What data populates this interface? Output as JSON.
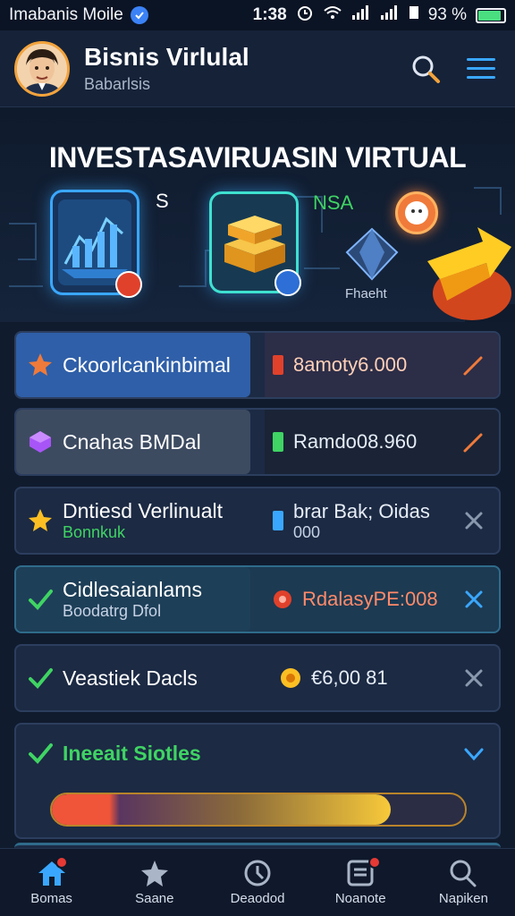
{
  "status_bar": {
    "carrier": "Imabanis Moile",
    "time": "1:38",
    "battery": "93 %"
  },
  "header": {
    "title": "Bisnis Virlulal",
    "subtitle": "Babarlsis"
  },
  "hero": {
    "headline": "INVESTASAVIRUASIN VIRTUAL",
    "label_s": "S",
    "label_nsa": "NSA",
    "label_fracht": "Fhaeht"
  },
  "cards": [
    {
      "title": "Ckoorlcankinbimal",
      "subtitle": "",
      "value": "8amoty6.000",
      "value2": ""
    },
    {
      "title": "Cnahas BMDal",
      "subtitle": "",
      "value": "Ramdo08.960",
      "value2": ""
    },
    {
      "title": "Dntiesd Verlinualt",
      "subtitle": "Bonnkuk",
      "value": "brar Bak; Oidas",
      "value2": "000"
    },
    {
      "title": "Cidlesaianlams",
      "subtitle": "Boodatrg Dfol",
      "value": "RdalasyPE:008",
      "value2": ""
    },
    {
      "title": "Veastiek Dacls",
      "subtitle": "",
      "value": "€6,00 81",
      "value2": ""
    },
    {
      "title": "Ineeait Siotles",
      "subtitle": "",
      "value": "",
      "value2": ""
    }
  ],
  "progress": {
    "fraction": 0.82
  },
  "nav": [
    {
      "label": "Bomas"
    },
    {
      "label": "Saane"
    },
    {
      "label": "Deaodod"
    },
    {
      "label": "Noanote"
    },
    {
      "label": "Napiken"
    }
  ],
  "colors": {
    "accent": "#3aa7ff",
    "orange": "#f07a3a",
    "green": "#3fd463",
    "background": "#101b2e"
  }
}
